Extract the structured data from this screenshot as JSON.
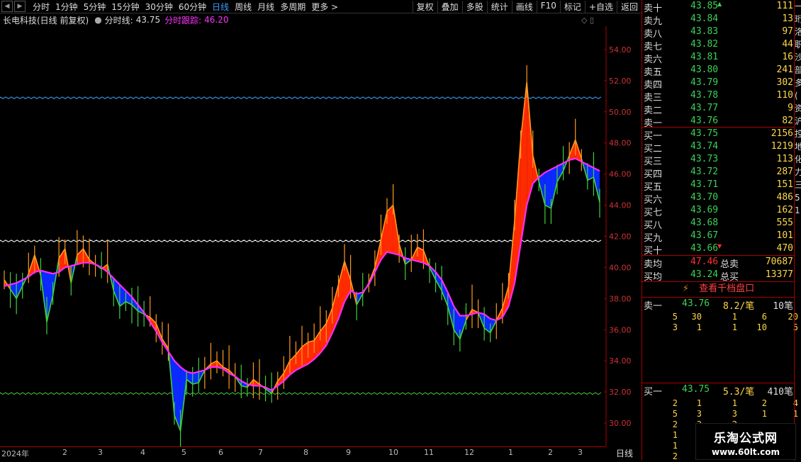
{
  "toolbar": {
    "periods": [
      "分时",
      "1分钟",
      "5分钟",
      "15分钟",
      "30分钟",
      "60分钟",
      "日线",
      "周线",
      "月线",
      "多周期",
      "更多 >"
    ],
    "active_period": "日线",
    "buttons": [
      "复权",
      "叠加",
      "多股",
      "统计",
      "画线",
      "F10",
      "标记",
      "+自选",
      "返回"
    ]
  },
  "info": {
    "stock": "长电科技(日线 前复权)",
    "line1_label": "分时线:",
    "line1_value": "43.75",
    "line2_label": "分时跟踪:",
    "line2_value": "46.20",
    "controls": "◇ ▯"
  },
  "colors": {
    "up": "#ff2a00",
    "down": "#0a2aff",
    "price_up": "#ff9a1f",
    "price_down": "#3fd13a",
    "track": "#ff2aff",
    "bg": "#000000",
    "grid": "#5a0000"
  },
  "chart_data": {
    "type": "area",
    "title": "",
    "ylim": [
      28.5,
      55.5
    ],
    "y_ticks": [
      "54.00",
      "52.00",
      "50.00",
      "48.00",
      "46.00",
      "44.00",
      "42.00",
      "40.00",
      "38.00",
      "36.00",
      "34.00",
      "32.00",
      "30.00"
    ],
    "ref_lines": [
      {
        "value": 50.9,
        "color": "#3aa0ff"
      },
      {
        "value": 41.7,
        "color": "#ffffff"
      },
      {
        "value": 31.9,
        "color": "#3fd13a"
      }
    ],
    "x_ticks": [
      "2024年",
      "2",
      "3",
      "4",
      "5",
      "6",
      "7",
      "8",
      "9",
      "10",
      "11",
      "12",
      "1",
      "2",
      "3"
    ],
    "series": [
      {
        "name": "分时线",
        "role": "price",
        "values": [
          39.2,
          38.6,
          38.0,
          38.8,
          39.6,
          40.8,
          39.5,
          36.5,
          38.2,
          40.6,
          41.2,
          39.0,
          40.8,
          41.2,
          40.5,
          40.2,
          39.9,
          40.2,
          38.5,
          37.5,
          37.8,
          37.6,
          37.2,
          37.0,
          36.8,
          36.4,
          35.4,
          34.8,
          30.5,
          29.5,
          32.8,
          32.5,
          32.6,
          33.4,
          33.8,
          34.0,
          33.6,
          33.4,
          33.0,
          32.4,
          32.3,
          32.8,
          32.5,
          32.2,
          31.9,
          32.7,
          33.2,
          34.0,
          34.4,
          34.9,
          35.2,
          35.3,
          35.9,
          36.4,
          37.4,
          38.9,
          40.4,
          39.2,
          37.6,
          38.3,
          39.0,
          40.0,
          41.8,
          43.6,
          44.0,
          41.5,
          40.2,
          40.5,
          41.3,
          41.1,
          40.0,
          39.2,
          38.5,
          37.5,
          36.0,
          35.4,
          36.6,
          37.3,
          37.1,
          36.1,
          35.8,
          36.6,
          37.4,
          38.8,
          43.0,
          48.2,
          51.9,
          47.2,
          45.5,
          44.0,
          43.8,
          45.5,
          46.2,
          47.2,
          48.2,
          47.0,
          45.6,
          45.8,
          44.2
        ]
      },
      {
        "name": "分时跟踪",
        "role": "track",
        "values": [
          38.8,
          38.9,
          39.0,
          39.2,
          39.4,
          39.7,
          39.8,
          39.7,
          39.6,
          39.7,
          40.0,
          40.1,
          40.2,
          40.3,
          40.3,
          40.2,
          40.0,
          39.7,
          39.3,
          38.9,
          38.5,
          38.1,
          37.6,
          37.1,
          36.5,
          35.9,
          35.2,
          34.6,
          34.0,
          33.6,
          33.3,
          33.2,
          33.3,
          33.4,
          33.6,
          33.6,
          33.5,
          33.2,
          33.0,
          32.7,
          32.5,
          32.4,
          32.4,
          32.3,
          32.1,
          32.4,
          32.7,
          33.1,
          33.4,
          33.6,
          33.8,
          34.1,
          34.5,
          35.0,
          35.8,
          36.7,
          37.8,
          38.5,
          38.3,
          38.4,
          38.9,
          39.7,
          40.5,
          41.0,
          40.9,
          40.8,
          40.6,
          40.5,
          40.4,
          40.3,
          40.1,
          39.7,
          39.2,
          38.4,
          37.5,
          36.9,
          36.9,
          37.0,
          37.1,
          37.0,
          36.7,
          36.6,
          36.8,
          37.5,
          39.0,
          41.5,
          44.0,
          45.4,
          45.8,
          46.1,
          46.3,
          46.5,
          46.7,
          46.9,
          47.0,
          46.8,
          46.6,
          46.4,
          46.2
        ]
      }
    ]
  },
  "order_book": {
    "asks": [
      {
        "label": "卖十",
        "price": "43.85",
        "vol": "111",
        "mark": "▲"
      },
      {
        "label": "卖九",
        "price": "43.84",
        "vol": "13",
        "mark": ""
      },
      {
        "label": "卖八",
        "price": "43.83",
        "vol": "97",
        "mark": ""
      },
      {
        "label": "卖七",
        "price": "43.82",
        "vol": "44",
        "mark": ""
      },
      {
        "label": "卖六",
        "price": "43.81",
        "vol": "16",
        "mark": ""
      },
      {
        "label": "卖五",
        "price": "43.80",
        "vol": "241",
        "mark": ""
      },
      {
        "label": "卖四",
        "price": "43.79",
        "vol": "302",
        "mark": ""
      },
      {
        "label": "卖三",
        "price": "43.78",
        "vol": "110",
        "mark": ""
      },
      {
        "label": "卖二",
        "price": "43.77",
        "vol": "9",
        "mark": ""
      },
      {
        "label": "卖一",
        "price": "43.76",
        "vol": "82",
        "mark": ""
      }
    ],
    "bids": [
      {
        "label": "买一",
        "price": "43.75",
        "vol": "2156",
        "mark": ""
      },
      {
        "label": "买二",
        "price": "43.74",
        "vol": "1219",
        "mark": ""
      },
      {
        "label": "买三",
        "price": "43.73",
        "vol": "113",
        "mark": ""
      },
      {
        "label": "买四",
        "price": "43.72",
        "vol": "287",
        "mark": ""
      },
      {
        "label": "买五",
        "price": "43.71",
        "vol": "151",
        "mark": ""
      },
      {
        "label": "买六",
        "price": "43.70",
        "vol": "486",
        "mark": ""
      },
      {
        "label": "买七",
        "price": "43.69",
        "vol": "162",
        "mark": ""
      },
      {
        "label": "买八",
        "price": "43.68",
        "vol": "555",
        "mark": ""
      },
      {
        "label": "买九",
        "price": "43.67",
        "vol": "101",
        "mark": ""
      },
      {
        "label": "买十",
        "price": "43.66",
        "vol": "470",
        "mark": "▼"
      }
    ],
    "summary": [
      {
        "a": "卖均",
        "b": "47.46",
        "b_color": "#ff3030",
        "c": "总卖",
        "d": "70687"
      },
      {
        "a": "买均",
        "b": "43.24",
        "b_color": "#39d353",
        "c": "总买",
        "d": "13377"
      }
    ],
    "button": "查看千档盘口",
    "sell1": {
      "label": "卖一",
      "price": "43.76",
      "avg": "8.2/笔",
      "count": "10笔"
    },
    "sell_queue": [
      [
        "5",
        "30",
        "1",
        "6",
        "20"
      ],
      [
        "3",
        "1",
        "1",
        "10",
        "5"
      ]
    ],
    "buy1": {
      "label": "买一",
      "price": "43.75",
      "avg": "5.3/笔",
      "count": "410笔"
    },
    "buy_queue": [
      [
        "2",
        "1",
        "1",
        "2",
        "4"
      ],
      [
        "5",
        "3",
        "3",
        "1",
        "1"
      ],
      [
        "2",
        "3",
        "2",
        "",
        ""
      ],
      [
        "1",
        "",
        "",
        "",
        ""
      ],
      [
        "1",
        "",
        "",
        "",
        ""
      ],
      [
        "2",
        "",
        "",
        "",
        ""
      ]
    ]
  },
  "date_period": "日线",
  "edge_text": [
    "一",
    "珩",
    "洛",
    "职",
    "沙",
    "部",
    "多",
    "(",
    "资",
    "沪",
    "控",
    "地",
    "化",
    "力",
    "三",
    "5",
    "1"
  ],
  "watermark": {
    "line1": "乐淘公式网",
    "line2": "www.60lt.com"
  }
}
